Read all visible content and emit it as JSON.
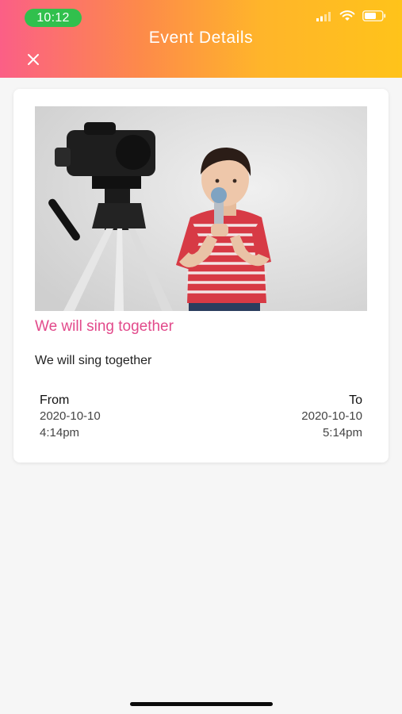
{
  "status_bar": {
    "time": "10:12",
    "icons": [
      "signal-icon",
      "wifi-icon",
      "battery-icon"
    ]
  },
  "header": {
    "title": "Event Details",
    "close_icon": "close-icon",
    "gradient_colors": [
      "#fb5f86",
      "#fd8a4a",
      "#ffb52a",
      "#ffc31a"
    ]
  },
  "event": {
    "image": "photo of a boy singing into a microphone beside a camera on a tripod",
    "title": "We will sing together",
    "description": "We will sing together",
    "from": {
      "label": "From",
      "date": "2020-10-10",
      "time": "4:14pm"
    },
    "to": {
      "label": "To",
      "date": "2020-10-10",
      "time": "5:14pm"
    }
  },
  "colors": {
    "title": "#e24a8b",
    "background": "#f6f6f6",
    "time_pill": "#31c04d"
  }
}
